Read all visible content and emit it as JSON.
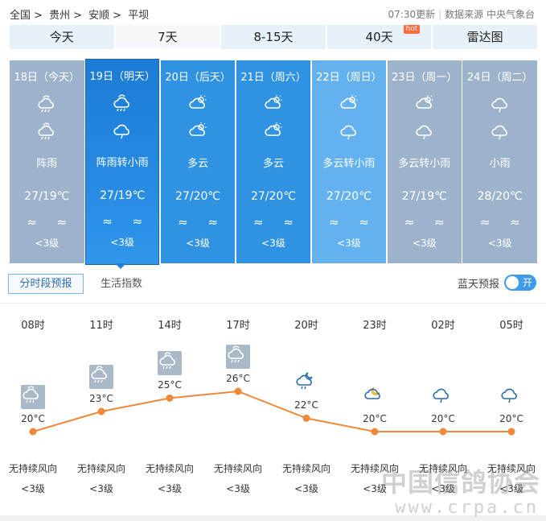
{
  "breadcrumb": {
    "items": [
      "全国",
      "贵州",
      "安顺",
      "平坝"
    ],
    "sep": ">"
  },
  "meta": {
    "updated": "07:30更新",
    "source": "数据来源 中央气象台"
  },
  "tabs": [
    {
      "label": "今天",
      "hot": ""
    },
    {
      "label": "7天",
      "hot": ""
    },
    {
      "label": "8-15天",
      "hot": ""
    },
    {
      "label": "40天",
      "hot": "hot"
    },
    {
      "label": "雷达图",
      "hot": ""
    }
  ],
  "active_tab": 1,
  "days": [
    {
      "date": "18日（今天）",
      "icon1": "shower-icon",
      "icon2": "shower-icon",
      "cond": "阵雨",
      "temp": "27/19℃",
      "wind": "≈ ≈",
      "level": "<3级",
      "color": "#9db3cb"
    },
    {
      "date": "19日（明天）",
      "icon1": "shower-icon",
      "icon2": "rain-icon",
      "cond": "阵雨转小雨",
      "temp": "27/19℃",
      "wind": "≈ ≈",
      "level": "<3级",
      "color": "#1e82d8"
    },
    {
      "date": "20日（后天）",
      "icon1": "partly-cloudy-icon",
      "icon2": "partly-cloudy-icon",
      "cond": "多云",
      "temp": "27/20℃",
      "wind": "≈ ≈",
      "level": "<3级",
      "color": "#2f92e2"
    },
    {
      "date": "21日（周六）",
      "icon1": "partly-cloudy-icon",
      "icon2": "partly-cloudy-icon",
      "cond": "多云",
      "temp": "27/20℃",
      "wind": "≈ ≈",
      "level": "<3级",
      "color": "#2f92e2"
    },
    {
      "date": "22日（周日）",
      "icon1": "partly-cloudy-icon",
      "icon2": "rain-icon",
      "cond": "多云转小雨",
      "temp": "27/20℃",
      "wind": "≈ ≈",
      "level": "<3级",
      "color": "#63b1ee"
    },
    {
      "date": "23日（周一）",
      "icon1": "partly-cloudy-icon",
      "icon2": "rain-icon",
      "cond": "多云转小雨",
      "temp": "27/19℃",
      "wind": "≈ ≈",
      "level": "<3级",
      "color": "#9db3cb"
    },
    {
      "date": "24日（周二）",
      "icon1": "rain-icon",
      "icon2": "rain-icon",
      "cond": "小雨",
      "temp": "28/20℃",
      "wind": "≈ ≈",
      "level": "<3级",
      "color": "#9db3cb"
    }
  ],
  "selected_day": 1,
  "subtabs": {
    "hourly": "分时段预报",
    "life": "生活指数"
  },
  "blue_sky": {
    "label": "蓝天预报",
    "toggle": "开"
  },
  "hourly": [
    {
      "time": "08时",
      "temp": "20°C",
      "temp_value": 20,
      "icon": "shower-icon",
      "wind": "无持续风向",
      "level": "<3级"
    },
    {
      "time": "11时",
      "temp": "23°C",
      "temp_value": 23,
      "icon": "shower-icon",
      "wind": "无持续风向",
      "level": "<3级"
    },
    {
      "time": "14时",
      "temp": "25°C",
      "temp_value": 25,
      "icon": "shower-icon",
      "wind": "无持续风向",
      "level": "<3级"
    },
    {
      "time": "17时",
      "temp": "26°C",
      "temp_value": 26,
      "icon": "shower-icon",
      "wind": "无持续风向",
      "level": "<3级"
    },
    {
      "time": "20时",
      "temp": "22°C",
      "temp_value": 22,
      "icon": "night-shower-icon",
      "wind": "无持续风向",
      "level": "<3级"
    },
    {
      "time": "23时",
      "temp": "20°C",
      "temp_value": 20,
      "icon": "night-cloudy-icon",
      "wind": "无持续风向",
      "level": "<3级"
    },
    {
      "time": "02时",
      "temp": "20°C",
      "temp_value": 20,
      "icon": "rain-icon",
      "wind": "无持续风向",
      "level": "<3级"
    },
    {
      "time": "05时",
      "temp": "20°C",
      "temp_value": 20,
      "icon": "rain-icon",
      "wind": "无持续风向",
      "level": "<3级"
    }
  ],
  "colors": {
    "line": "#f0883a",
    "accent": "#3d9be9"
  },
  "watermark": {
    "cn": "中国信鸽协会",
    "url": "www.crpa.cn"
  }
}
